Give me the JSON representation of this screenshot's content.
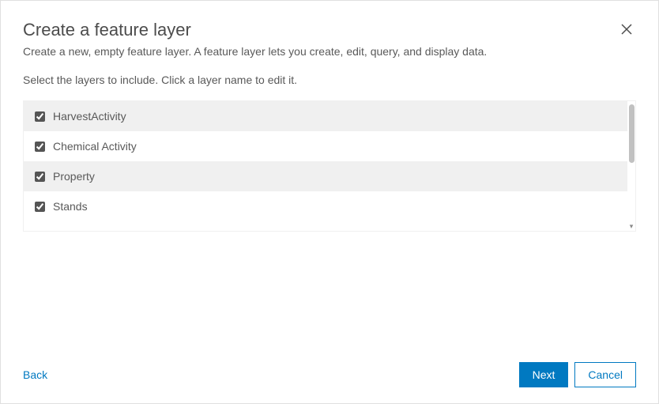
{
  "header": {
    "title": "Create a feature layer",
    "subtitle": "Create a new, empty feature layer. A feature layer lets you create, edit, query, and display data.",
    "instruction": "Select the layers to include. Click a layer name to edit it."
  },
  "layers": [
    {
      "name": "HarvestActivity",
      "checked": true
    },
    {
      "name": "Chemical Activity",
      "checked": true
    },
    {
      "name": "Property",
      "checked": true
    },
    {
      "name": "Stands",
      "checked": true
    }
  ],
  "footer": {
    "back": "Back",
    "next": "Next",
    "cancel": "Cancel"
  }
}
